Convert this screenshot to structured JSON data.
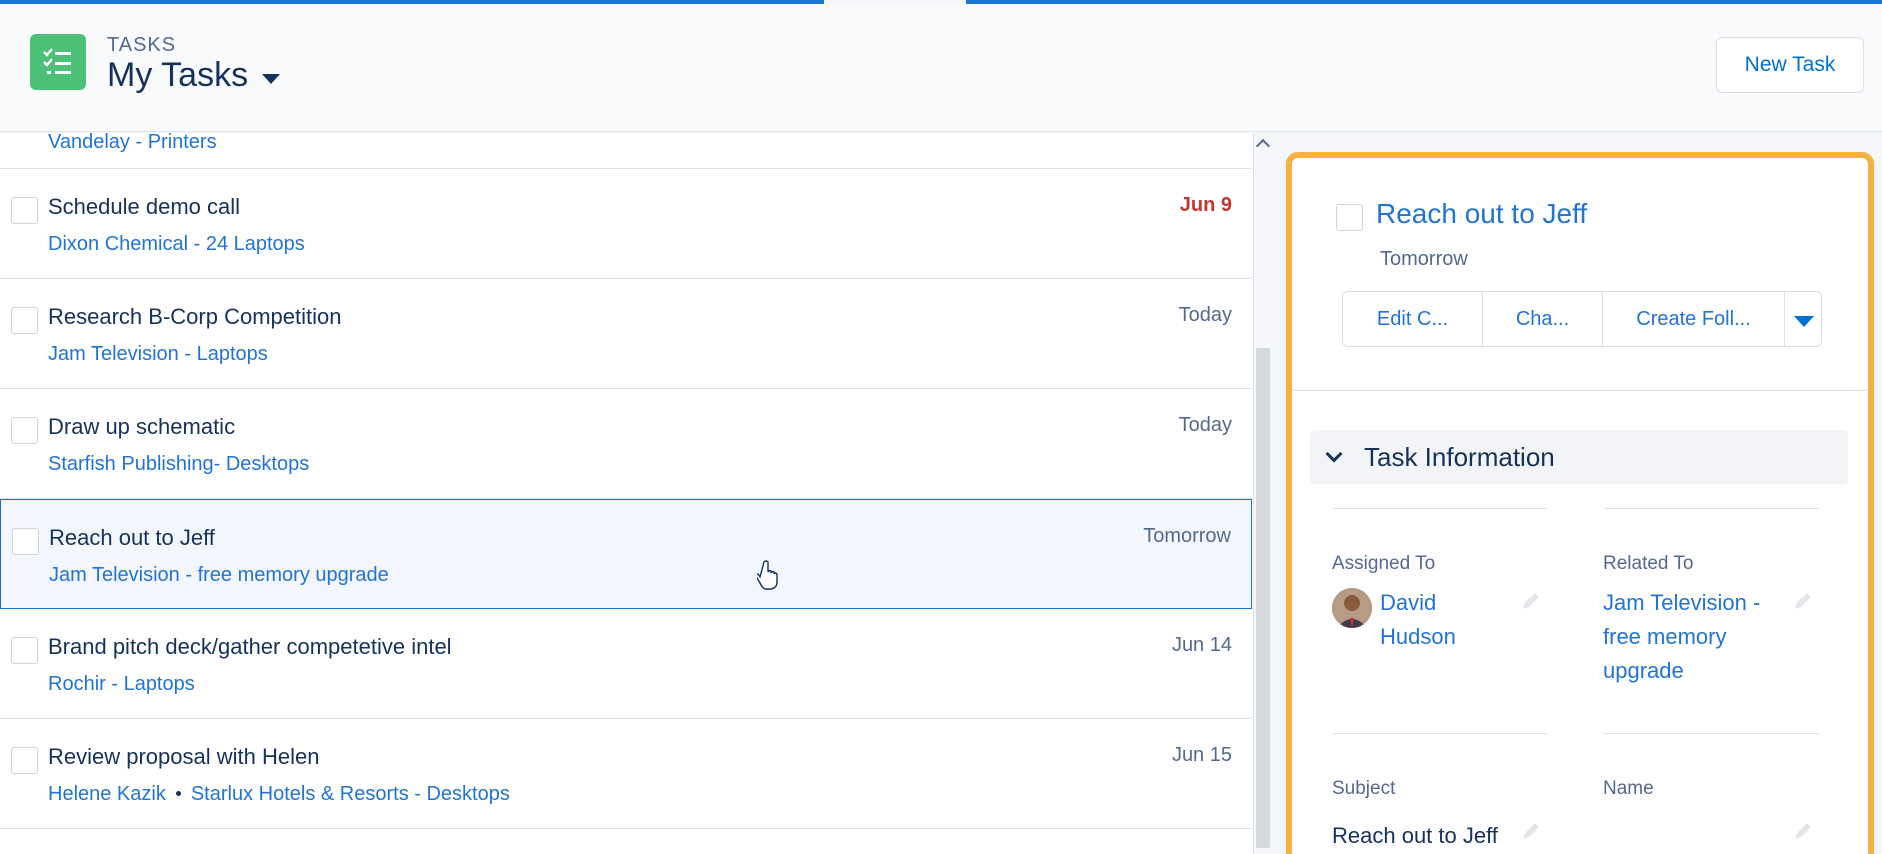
{
  "header": {
    "object_label": "TASKS",
    "title": "My Tasks",
    "new_task_label": "New Task"
  },
  "list": {
    "partial_row_related": "Vandelay - Printers",
    "rows": [
      {
        "subject": "Schedule demo call",
        "related": [
          "Dixon Chemical - 24 Laptops"
        ],
        "date": "Jun 9",
        "overdue": true
      },
      {
        "subject": "Research B-Corp Competition",
        "related": [
          "Jam Television - Laptops"
        ],
        "date": "Today",
        "overdue": false
      },
      {
        "subject": "Draw up schematic",
        "related": [
          "Starfish Publishing- Desktops"
        ],
        "date": "Today",
        "overdue": false
      },
      {
        "subject": "Reach out to Jeff",
        "related": [
          "Jam Television - free memory upgrade"
        ],
        "date": "Tomorrow",
        "overdue": false,
        "selected": true
      },
      {
        "subject": "Brand pitch deck/gather competetive intel",
        "related": [
          "Rochir - Laptops"
        ],
        "date": "Jun 14",
        "overdue": false
      },
      {
        "subject": "Review proposal with Helen",
        "related": [
          "Helene Kazik",
          "Starlux Hotels & Resorts - Desktops"
        ],
        "date": "Jun 15",
        "overdue": false
      }
    ]
  },
  "detail": {
    "title": "Reach out to Jeff",
    "due": "Tomorrow",
    "actions": [
      "Edit C...",
      "Cha...",
      "Create Foll..."
    ],
    "section_title": "Task Information",
    "assigned_to_label": "Assigned To",
    "assigned_to_line1": "David",
    "assigned_to_line2": "Hudson",
    "related_to_label": "Related To",
    "related_to_line1": "Jam Television -",
    "related_to_line2": "free memory",
    "related_to_line3": "upgrade",
    "subject_label": "Subject",
    "subject_value": "Reach out to Jeff",
    "name_label": "Name"
  },
  "colors": {
    "accent": "#0070d2",
    "overdue": "#c23934",
    "highlight_border": "#f5b041",
    "app_icon": "#4bc076"
  },
  "icons": [
    "task-list-icon",
    "chevron-down-icon",
    "scroll-up-icon",
    "pencil-icon",
    "hand-cursor-icon"
  ]
}
